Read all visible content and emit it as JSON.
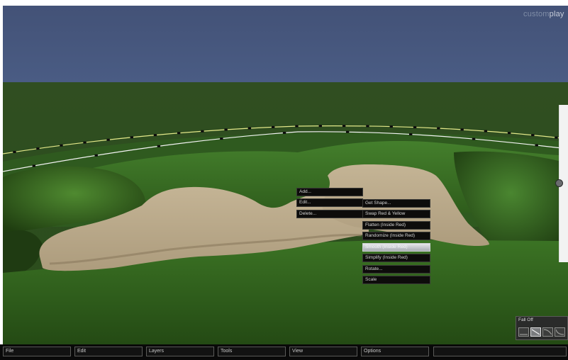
{
  "logo": {
    "part1": "custom",
    "part2": "play"
  },
  "context_menu": {
    "primary": [
      {
        "label": "Add..."
      },
      {
        "label": "Edit..."
      },
      {
        "label": "Delete..."
      }
    ],
    "secondary": [
      {
        "label": "Get Shape..."
      },
      {
        "label": "Swap Red & Yellow"
      },
      {
        "label": "Flatten (Inside Red)"
      },
      {
        "label": "Randomize (Inside Red)"
      },
      {
        "label": "Smooth (Inside Red)",
        "selected": true
      },
      {
        "label": "Simplify (Inside Red)"
      },
      {
        "label": "Rotate..."
      },
      {
        "label": "Scale"
      }
    ]
  },
  "falloff": {
    "title": "Fall Off",
    "buttons": [
      {
        "icon": "falloff-flat-icon"
      },
      {
        "icon": "falloff-linear-icon",
        "active": true
      },
      {
        "icon": "falloff-curve-icon"
      },
      {
        "icon": "falloff-sharp-icon"
      }
    ]
  },
  "taskbar": {
    "items": [
      {
        "label": "File"
      },
      {
        "label": "Edit"
      },
      {
        "label": "Layers"
      },
      {
        "label": "Tools"
      },
      {
        "label": "View"
      },
      {
        "label": "Options"
      },
      {
        "label": ""
      }
    ]
  },
  "colors": {
    "sky": "#44557e",
    "grass_far": "#2f5a1c",
    "grass_near": "#2e5f1b",
    "sand": "#bba98b",
    "menu_bg": "#0d0c0b",
    "menu_selected": "#c3c6cc"
  }
}
